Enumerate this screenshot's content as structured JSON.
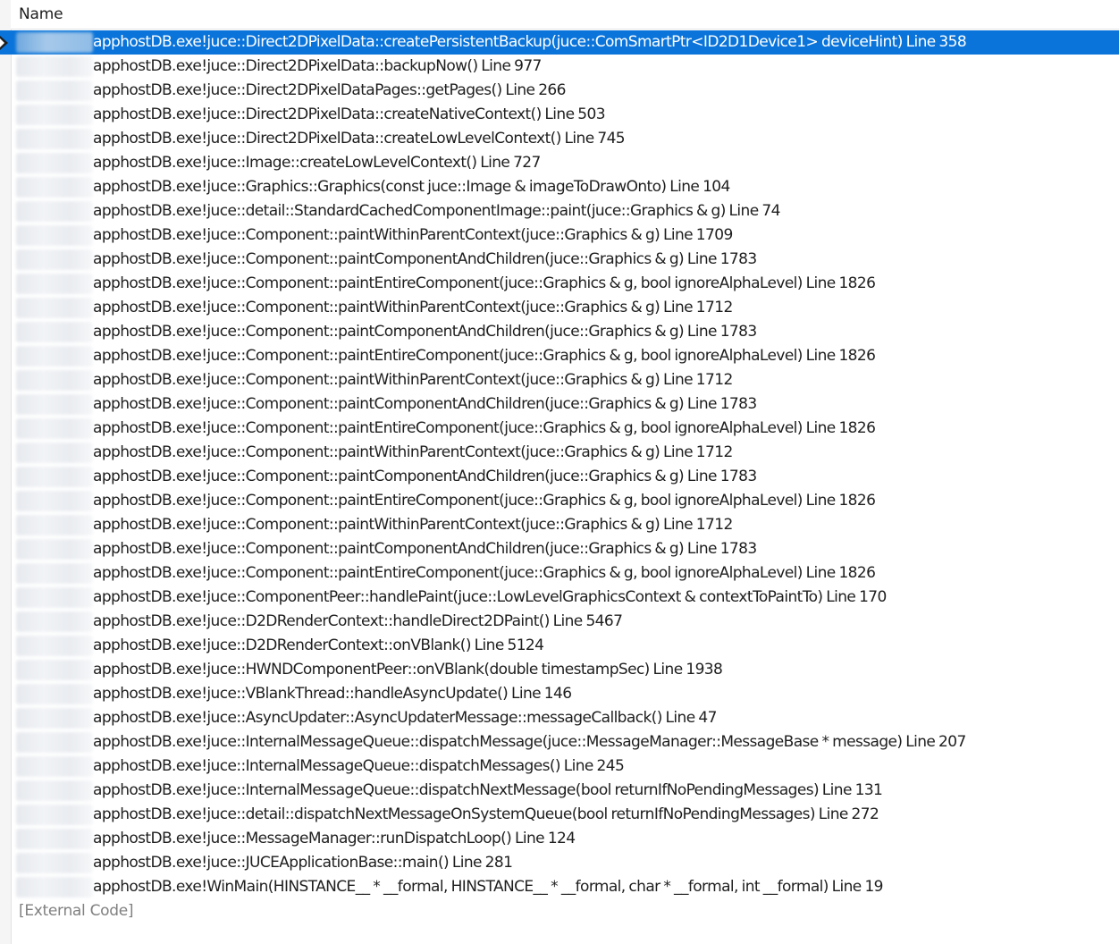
{
  "header": {
    "name_label": "Name"
  },
  "frames": [
    {
      "text": "apphostDB.exe!juce::Direct2DPixelData::createPersistentBackup(juce::ComSmartPtr<ID2D1Device1> deviceHint) Line 358",
      "selected": true,
      "current": true
    },
    {
      "text": "apphostDB.exe!juce::Direct2DPixelData::backupNow() Line 977"
    },
    {
      "text": "apphostDB.exe!juce::Direct2DPixelDataPages::getPages() Line 266"
    },
    {
      "text": "apphostDB.exe!juce::Direct2DPixelData::createNativeContext() Line 503"
    },
    {
      "text": "apphostDB.exe!juce::Direct2DPixelData::createLowLevelContext() Line 745"
    },
    {
      "text": "apphostDB.exe!juce::Image::createLowLevelContext() Line 727"
    },
    {
      "text": "apphostDB.exe!juce::Graphics::Graphics(const juce::Image & imageToDrawOnto) Line 104"
    },
    {
      "text": "apphostDB.exe!juce::detail::StandardCachedComponentImage::paint(juce::Graphics & g) Line 74"
    },
    {
      "text": "apphostDB.exe!juce::Component::paintWithinParentContext(juce::Graphics & g) Line 1709"
    },
    {
      "text": "apphostDB.exe!juce::Component::paintComponentAndChildren(juce::Graphics & g) Line 1783"
    },
    {
      "text": "apphostDB.exe!juce::Component::paintEntireComponent(juce::Graphics & g, bool ignoreAlphaLevel) Line 1826"
    },
    {
      "text": "apphostDB.exe!juce::Component::paintWithinParentContext(juce::Graphics & g) Line 1712"
    },
    {
      "text": "apphostDB.exe!juce::Component::paintComponentAndChildren(juce::Graphics & g) Line 1783"
    },
    {
      "text": "apphostDB.exe!juce::Component::paintEntireComponent(juce::Graphics & g, bool ignoreAlphaLevel) Line 1826"
    },
    {
      "text": "apphostDB.exe!juce::Component::paintWithinParentContext(juce::Graphics & g) Line 1712"
    },
    {
      "text": "apphostDB.exe!juce::Component::paintComponentAndChildren(juce::Graphics & g) Line 1783"
    },
    {
      "text": "apphostDB.exe!juce::Component::paintEntireComponent(juce::Graphics & g, bool ignoreAlphaLevel) Line 1826"
    },
    {
      "text": "apphostDB.exe!juce::Component::paintWithinParentContext(juce::Graphics & g) Line 1712"
    },
    {
      "text": "apphostDB.exe!juce::Component::paintComponentAndChildren(juce::Graphics & g) Line 1783"
    },
    {
      "text": "apphostDB.exe!juce::Component::paintEntireComponent(juce::Graphics & g, bool ignoreAlphaLevel) Line 1826"
    },
    {
      "text": "apphostDB.exe!juce::Component::paintWithinParentContext(juce::Graphics & g) Line 1712"
    },
    {
      "text": "apphostDB.exe!juce::Component::paintComponentAndChildren(juce::Graphics & g) Line 1783"
    },
    {
      "text": "apphostDB.exe!juce::Component::paintEntireComponent(juce::Graphics & g, bool ignoreAlphaLevel) Line 1826"
    },
    {
      "text": "apphostDB.exe!juce::ComponentPeer::handlePaint(juce::LowLevelGraphicsContext & contextToPaintTo) Line 170"
    },
    {
      "text": "apphostDB.exe!juce::D2DRenderContext::handleDirect2DPaint() Line 5467"
    },
    {
      "text": "apphostDB.exe!juce::D2DRenderContext::onVBlank() Line 5124"
    },
    {
      "text": "apphostDB.exe!juce::HWNDComponentPeer::onVBlank(double timestampSec) Line 1938"
    },
    {
      "text": "apphostDB.exe!juce::VBlankThread::handleAsyncUpdate() Line 146"
    },
    {
      "text": "apphostDB.exe!juce::AsyncUpdater::AsyncUpdaterMessage::messageCallback() Line 47"
    },
    {
      "text": "apphostDB.exe!juce::InternalMessageQueue::dispatchMessage(juce::MessageManager::MessageBase * message) Line 207"
    },
    {
      "text": "apphostDB.exe!juce::InternalMessageQueue::dispatchMessages() Line 245"
    },
    {
      "text": "apphostDB.exe!juce::InternalMessageQueue::dispatchNextMessage(bool returnIfNoPendingMessages) Line 131"
    },
    {
      "text": "apphostDB.exe!juce::detail::dispatchNextMessageOnSystemQueue(bool returnIfNoPendingMessages) Line 272"
    },
    {
      "text": "apphostDB.exe!juce::MessageManager::runDispatchLoop() Line 124"
    },
    {
      "text": "apphostDB.exe!juce::JUCEApplicationBase::main() Line 281"
    },
    {
      "text": "apphostDB.exe!WinMain(HINSTANCE__ * __formal, HINSTANCE__ * __formal, char * __formal, int __formal) Line 19"
    }
  ],
  "external_code": "[External Code]",
  "colors": {
    "selection": "#0a74da",
    "text": "#1e1e1e",
    "external_text": "#808080"
  }
}
